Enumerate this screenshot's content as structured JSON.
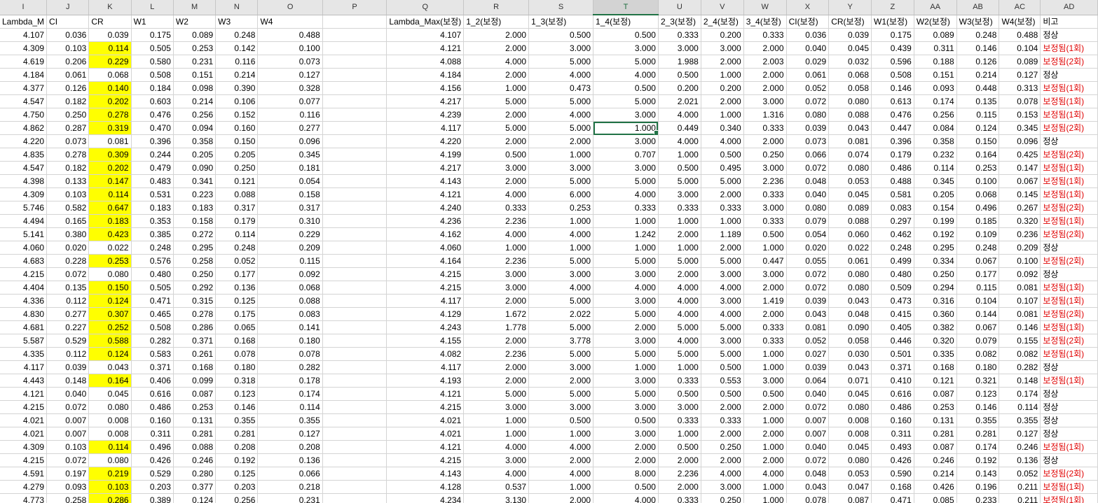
{
  "columns": [
    {
      "letter": "I",
      "header": "Lambda_M"
    },
    {
      "letter": "J",
      "header": "CI"
    },
    {
      "letter": "K",
      "header": "CR"
    },
    {
      "letter": "L",
      "header": "W1"
    },
    {
      "letter": "M",
      "header": "W2"
    },
    {
      "letter": "N",
      "header": "W3"
    },
    {
      "letter": "O",
      "header": "W4"
    },
    {
      "letter": "P",
      "header": ""
    },
    {
      "letter": "Q",
      "header": "Lambda_Max(보정)"
    },
    {
      "letter": "R",
      "header": "1_2(보정)"
    },
    {
      "letter": "S",
      "header": "1_3(보정)"
    },
    {
      "letter": "T",
      "header": "1_4(보정)"
    },
    {
      "letter": "U",
      "header": "2_3(보정)"
    },
    {
      "letter": "V",
      "header": "2_4(보정)"
    },
    {
      "letter": "W",
      "header": "3_4(보정)"
    },
    {
      "letter": "X",
      "header": "CI(보정)"
    },
    {
      "letter": "Y",
      "header": "CR(보정)"
    },
    {
      "letter": "Z",
      "header": "W1(보정)"
    },
    {
      "letter": "AA",
      "header": "W2(보정)"
    },
    {
      "letter": "AB",
      "header": "W3(보정)"
    },
    {
      "letter": "AC",
      "header": "W4(보정)"
    },
    {
      "letter": "AD",
      "header": "비고"
    }
  ],
  "selected_column": "T",
  "active_cell": {
    "row": 7,
    "col": "T"
  },
  "highlight_color": "#ffff00",
  "status_colors": {
    "정상": "#000000",
    "corrected": "#e00000"
  },
  "rows": [
    [
      "4.107",
      "0.036",
      "0.039",
      "0.175",
      "0.089",
      "0.248",
      "0.488",
      "",
      "4.107",
      "2.000",
      "0.500",
      "0.500",
      "0.333",
      "0.200",
      "0.333",
      "0.036",
      "0.039",
      "0.175",
      "0.089",
      "0.248",
      "0.488",
      "정상"
    ],
    [
      "4.309",
      "0.103",
      "0.114",
      "0.505",
      "0.253",
      "0.142",
      "0.100",
      "",
      "4.121",
      "2.000",
      "3.000",
      "3.000",
      "3.000",
      "3.000",
      "2.000",
      "0.040",
      "0.045",
      "0.439",
      "0.311",
      "0.146",
      "0.104",
      "보정됨(1회)"
    ],
    [
      "4.619",
      "0.206",
      "0.229",
      "0.580",
      "0.231",
      "0.116",
      "0.073",
      "",
      "4.088",
      "4.000",
      "5.000",
      "5.000",
      "1.988",
      "2.000",
      "2.003",
      "0.029",
      "0.032",
      "0.596",
      "0.188",
      "0.126",
      "0.089",
      "보정됨(2회)"
    ],
    [
      "4.184",
      "0.061",
      "0.068",
      "0.508",
      "0.151",
      "0.214",
      "0.127",
      "",
      "4.184",
      "2.000",
      "4.000",
      "4.000",
      "0.500",
      "1.000",
      "2.000",
      "0.061",
      "0.068",
      "0.508",
      "0.151",
      "0.214",
      "0.127",
      "정상"
    ],
    [
      "4.377",
      "0.126",
      "0.140",
      "0.184",
      "0.098",
      "0.390",
      "0.328",
      "",
      "4.156",
      "1.000",
      "0.473",
      "0.500",
      "0.200",
      "0.200",
      "2.000",
      "0.052",
      "0.058",
      "0.146",
      "0.093",
      "0.448",
      "0.313",
      "보정됨(1회)"
    ],
    [
      "4.547",
      "0.182",
      "0.202",
      "0.603",
      "0.214",
      "0.106",
      "0.077",
      "",
      "4.217",
      "5.000",
      "5.000",
      "5.000",
      "2.021",
      "2.000",
      "3.000",
      "0.072",
      "0.080",
      "0.613",
      "0.174",
      "0.135",
      "0.078",
      "보정됨(1회)"
    ],
    [
      "4.750",
      "0.250",
      "0.278",
      "0.476",
      "0.256",
      "0.152",
      "0.116",
      "",
      "4.239",
      "2.000",
      "4.000",
      "3.000",
      "4.000",
      "1.000",
      "1.316",
      "0.080",
      "0.088",
      "0.476",
      "0.256",
      "0.115",
      "0.153",
      "보정됨(1회)"
    ],
    [
      "4.862",
      "0.287",
      "0.319",
      "0.470",
      "0.094",
      "0.160",
      "0.277",
      "",
      "4.117",
      "5.000",
      "5.000",
      "1.000",
      "0.449",
      "0.340",
      "0.333",
      "0.039",
      "0.043",
      "0.447",
      "0.084",
      "0.124",
      "0.345",
      "보정됨(2회)"
    ],
    [
      "4.220",
      "0.073",
      "0.081",
      "0.396",
      "0.358",
      "0.150",
      "0.096",
      "",
      "4.220",
      "2.000",
      "2.000",
      "3.000",
      "4.000",
      "4.000",
      "2.000",
      "0.073",
      "0.081",
      "0.396",
      "0.358",
      "0.150",
      "0.096",
      "정상"
    ],
    [
      "4.835",
      "0.278",
      "0.309",
      "0.244",
      "0.205",
      "0.205",
      "0.345",
      "",
      "4.199",
      "0.500",
      "1.000",
      "0.707",
      "1.000",
      "0.500",
      "0.250",
      "0.066",
      "0.074",
      "0.179",
      "0.232",
      "0.164",
      "0.425",
      "보정됨(2회)"
    ],
    [
      "4.547",
      "0.182",
      "0.202",
      "0.479",
      "0.090",
      "0.250",
      "0.181",
      "",
      "4.217",
      "3.000",
      "3.000",
      "3.000",
      "0.500",
      "0.495",
      "3.000",
      "0.072",
      "0.080",
      "0.486",
      "0.114",
      "0.253",
      "0.147",
      "보정됨(1회)"
    ],
    [
      "4.398",
      "0.133",
      "0.147",
      "0.483",
      "0.341",
      "0.121",
      "0.054",
      "",
      "4.143",
      "2.000",
      "5.000",
      "5.000",
      "5.000",
      "5.000",
      "2.236",
      "0.048",
      "0.053",
      "0.488",
      "0.345",
      "0.100",
      "0.067",
      "보정됨(1회)"
    ],
    [
      "4.309",
      "0.103",
      "0.114",
      "0.531",
      "0.223",
      "0.088",
      "0.158",
      "",
      "4.121",
      "4.000",
      "6.000",
      "4.000",
      "3.000",
      "2.000",
      "0.333",
      "0.040",
      "0.045",
      "0.581",
      "0.205",
      "0.068",
      "0.145",
      "보정됨(1회)"
    ],
    [
      "5.746",
      "0.582",
      "0.647",
      "0.183",
      "0.183",
      "0.317",
      "0.317",
      "",
      "4.240",
      "0.333",
      "0.253",
      "0.333",
      "0.333",
      "0.333",
      "3.000",
      "0.080",
      "0.089",
      "0.083",
      "0.154",
      "0.496",
      "0.267",
      "보정됨(2회)"
    ],
    [
      "4.494",
      "0.165",
      "0.183",
      "0.353",
      "0.158",
      "0.179",
      "0.310",
      "",
      "4.236",
      "2.236",
      "1.000",
      "1.000",
      "1.000",
      "1.000",
      "0.333",
      "0.079",
      "0.088",
      "0.297",
      "0.199",
      "0.185",
      "0.320",
      "보정됨(1회)"
    ],
    [
      "5.141",
      "0.380",
      "0.423",
      "0.385",
      "0.272",
      "0.114",
      "0.229",
      "",
      "4.162",
      "4.000",
      "4.000",
      "1.242",
      "2.000",
      "1.189",
      "0.500",
      "0.054",
      "0.060",
      "0.462",
      "0.192",
      "0.109",
      "0.236",
      "보정됨(2회)"
    ],
    [
      "4.060",
      "0.020",
      "0.022",
      "0.248",
      "0.295",
      "0.248",
      "0.209",
      "",
      "4.060",
      "1.000",
      "1.000",
      "1.000",
      "1.000",
      "2.000",
      "1.000",
      "0.020",
      "0.022",
      "0.248",
      "0.295",
      "0.248",
      "0.209",
      "정상"
    ],
    [
      "4.683",
      "0.228",
      "0.253",
      "0.576",
      "0.258",
      "0.052",
      "0.115",
      "",
      "4.164",
      "2.236",
      "5.000",
      "5.000",
      "5.000",
      "5.000",
      "0.447",
      "0.055",
      "0.061",
      "0.499",
      "0.334",
      "0.067",
      "0.100",
      "보정됨(2회)"
    ],
    [
      "4.215",
      "0.072",
      "0.080",
      "0.480",
      "0.250",
      "0.177",
      "0.092",
      "",
      "4.215",
      "3.000",
      "3.000",
      "3.000",
      "2.000",
      "3.000",
      "3.000",
      "0.072",
      "0.080",
      "0.480",
      "0.250",
      "0.177",
      "0.092",
      "정상"
    ],
    [
      "4.404",
      "0.135",
      "0.150",
      "0.505",
      "0.292",
      "0.136",
      "0.068",
      "",
      "4.215",
      "3.000",
      "4.000",
      "4.000",
      "4.000",
      "4.000",
      "2.000",
      "0.072",
      "0.080",
      "0.509",
      "0.294",
      "0.115",
      "0.081",
      "보정됨(1회)"
    ],
    [
      "4.336",
      "0.112",
      "0.124",
      "0.471",
      "0.315",
      "0.125",
      "0.088",
      "",
      "4.117",
      "2.000",
      "5.000",
      "3.000",
      "4.000",
      "3.000",
      "1.419",
      "0.039",
      "0.043",
      "0.473",
      "0.316",
      "0.104",
      "0.107",
      "보정됨(1회)"
    ],
    [
      "4.830",
      "0.277",
      "0.307",
      "0.465",
      "0.278",
      "0.175",
      "0.083",
      "",
      "4.129",
      "1.672",
      "2.022",
      "5.000",
      "4.000",
      "4.000",
      "2.000",
      "0.043",
      "0.048",
      "0.415",
      "0.360",
      "0.144",
      "0.081",
      "보정됨(2회)"
    ],
    [
      "4.681",
      "0.227",
      "0.252",
      "0.508",
      "0.286",
      "0.065",
      "0.141",
      "",
      "4.243",
      "1.778",
      "5.000",
      "2.000",
      "5.000",
      "5.000",
      "0.333",
      "0.081",
      "0.090",
      "0.405",
      "0.382",
      "0.067",
      "0.146",
      "보정됨(1회)"
    ],
    [
      "5.587",
      "0.529",
      "0.588",
      "0.282",
      "0.371",
      "0.168",
      "0.180",
      "",
      "4.155",
      "2.000",
      "3.778",
      "3.000",
      "4.000",
      "3.000",
      "0.333",
      "0.052",
      "0.058",
      "0.446",
      "0.320",
      "0.079",
      "0.155",
      "보정됨(2회)"
    ],
    [
      "4.335",
      "0.112",
      "0.124",
      "0.583",
      "0.261",
      "0.078",
      "0.078",
      "",
      "4.082",
      "2.236",
      "5.000",
      "5.000",
      "5.000",
      "5.000",
      "1.000",
      "0.027",
      "0.030",
      "0.501",
      "0.335",
      "0.082",
      "0.082",
      "보정됨(1회)"
    ],
    [
      "4.117",
      "0.039",
      "0.043",
      "0.371",
      "0.168",
      "0.180",
      "0.282",
      "",
      "4.117",
      "2.000",
      "3.000",
      "1.000",
      "1.000",
      "0.500",
      "1.000",
      "0.039",
      "0.043",
      "0.371",
      "0.168",
      "0.180",
      "0.282",
      "정상"
    ],
    [
      "4.443",
      "0.148",
      "0.164",
      "0.406",
      "0.099",
      "0.318",
      "0.178",
      "",
      "4.193",
      "2.000",
      "2.000",
      "3.000",
      "0.333",
      "0.553",
      "3.000",
      "0.064",
      "0.071",
      "0.410",
      "0.121",
      "0.321",
      "0.148",
      "보정됨(1회)"
    ],
    [
      "4.121",
      "0.040",
      "0.045",
      "0.616",
      "0.087",
      "0.123",
      "0.174",
      "",
      "4.121",
      "5.000",
      "5.000",
      "5.000",
      "0.500",
      "0.500",
      "0.500",
      "0.040",
      "0.045",
      "0.616",
      "0.087",
      "0.123",
      "0.174",
      "정상"
    ],
    [
      "4.215",
      "0.072",
      "0.080",
      "0.486",
      "0.253",
      "0.146",
      "0.114",
      "",
      "4.215",
      "3.000",
      "3.000",
      "3.000",
      "3.000",
      "2.000",
      "2.000",
      "0.072",
      "0.080",
      "0.486",
      "0.253",
      "0.146",
      "0.114",
      "정상"
    ],
    [
      "4.021",
      "0.007",
      "0.008",
      "0.160",
      "0.131",
      "0.355",
      "0.355",
      "",
      "4.021",
      "1.000",
      "0.500",
      "0.500",
      "0.333",
      "0.333",
      "1.000",
      "0.007",
      "0.008",
      "0.160",
      "0.131",
      "0.355",
      "0.355",
      "정상"
    ],
    [
      "4.021",
      "0.007",
      "0.008",
      "0.311",
      "0.281",
      "0.281",
      "0.127",
      "",
      "4.021",
      "1.000",
      "1.000",
      "3.000",
      "1.000",
      "2.000",
      "2.000",
      "0.007",
      "0.008",
      "0.311",
      "0.281",
      "0.281",
      "0.127",
      "정상"
    ],
    [
      "4.309",
      "0.103",
      "0.114",
      "0.496",
      "0.088",
      "0.208",
      "0.208",
      "",
      "4.121",
      "4.000",
      "4.000",
      "2.000",
      "0.500",
      "0.250",
      "1.000",
      "0.040",
      "0.045",
      "0.493",
      "0.087",
      "0.174",
      "0.246",
      "보정됨(1회)"
    ],
    [
      "4.215",
      "0.072",
      "0.080",
      "0.426",
      "0.246",
      "0.192",
      "0.136",
      "",
      "4.215",
      "3.000",
      "2.000",
      "2.000",
      "2.000",
      "2.000",
      "2.000",
      "0.072",
      "0.080",
      "0.426",
      "0.246",
      "0.192",
      "0.136",
      "정상"
    ],
    [
      "4.591",
      "0.197",
      "0.219",
      "0.529",
      "0.280",
      "0.125",
      "0.066",
      "",
      "4.143",
      "4.000",
      "4.000",
      "8.000",
      "2.236",
      "4.000",
      "4.000",
      "0.048",
      "0.053",
      "0.590",
      "0.214",
      "0.143",
      "0.052",
      "보정됨(2회)"
    ],
    [
      "4.279",
      "0.093",
      "0.103",
      "0.203",
      "0.377",
      "0.203",
      "0.218",
      "",
      "4.128",
      "0.537",
      "1.000",
      "0.500",
      "2.000",
      "3.000",
      "1.000",
      "0.043",
      "0.047",
      "0.168",
      "0.426",
      "0.196",
      "0.211",
      "보정됨(1회)"
    ],
    [
      "4.773",
      "0.258",
      "0.286",
      "0.389",
      "0.124",
      "0.256",
      "0.231",
      "",
      "4.234",
      "3.130",
      "2.000",
      "4.000",
      "0.333",
      "0.250",
      "1.000",
      "0.078",
      "0.087",
      "0.471",
      "0.085",
      "0.233",
      "0.211",
      "보정됨(1회)"
    ]
  ]
}
